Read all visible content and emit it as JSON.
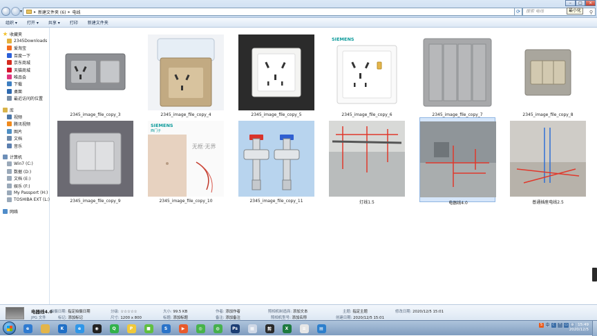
{
  "address": {
    "parts": [
      "新建文件夹 (6)",
      "电线"
    ],
    "search_placeholder": "搜索 电线",
    "tooltip": "最小化"
  },
  "toolbar": {
    "organize": "组织 ▾",
    "open": "打开 ▾",
    "share": "共享 ▾",
    "print": "打印",
    "new_folder": "新建文件夹"
  },
  "sidebar": {
    "favorites_label": "收藏夹",
    "favorites": [
      {
        "label": "2345Downloads",
        "color": "#e2b23e"
      },
      {
        "label": "爱淘宝",
        "color": "#f46b1d"
      },
      {
        "label": "百度一下",
        "color": "#2b5fd9"
      },
      {
        "label": "京东商城",
        "color": "#d52b1e"
      },
      {
        "label": "天猫商城",
        "color": "#d4142e"
      },
      {
        "label": "唯品会",
        "color": "#e0357f"
      },
      {
        "label": "下载",
        "color": "#3e7fc1"
      },
      {
        "label": "桌面",
        "color": "#2d69b0"
      },
      {
        "label": "最近访问的位置",
        "color": "#7a8ea6"
      }
    ],
    "library_label": "库",
    "libraries": [
      {
        "label": "视频",
        "color": "#4b76a8"
      },
      {
        "label": "腾讯视频",
        "color": "#f08a1c"
      },
      {
        "label": "图片",
        "color": "#4d8fc4"
      },
      {
        "label": "文档",
        "color": "#6e89a9"
      },
      {
        "label": "音乐",
        "color": "#5b7fb0"
      }
    ],
    "computer_label": "计算机",
    "drives": [
      {
        "label": "Win7 (C:)"
      },
      {
        "label": "数据 (D:)"
      },
      {
        "label": "文档 (E:)"
      },
      {
        "label": "娱乐 (F:)"
      },
      {
        "label": "My Passport (H:)"
      },
      {
        "label": "TOSHIBA EXT (L:)"
      }
    ],
    "network_label": "网络"
  },
  "files": [
    {
      "name": "2345_image_file_copy_3",
      "kind": "switch-socket-grey",
      "bg": "#ffffff"
    },
    {
      "name": "2345_image_file_copy_4",
      "kind": "socket-cover",
      "bg": "#eef2f5"
    },
    {
      "name": "2345_image_file_copy_5",
      "kind": "socket-dark",
      "bg": "#2b2b2b"
    },
    {
      "name": "2345_image_file_copy_6",
      "kind": "socket-usb",
      "bg": "#ffffff",
      "brand": "SIEMENS"
    },
    {
      "name": "2345_image_file_copy_7",
      "kind": "switch-four-grey",
      "bg": "#ffffff"
    },
    {
      "name": "2345_image_file_copy_8",
      "kind": "switch-three-gold",
      "bg": "#ffffff"
    },
    {
      "name": "2345_image_file_copy_9",
      "kind": "switch-two-silver",
      "bg": "#6b6a72"
    },
    {
      "name": "2345_image_file_copy_10",
      "kind": "glass-switch",
      "bg": "#fafafa",
      "brand": "SIEMENS",
      "brand_sub": "西门子",
      "slogan": "无框·无界"
    },
    {
      "name": "2345_image_file_copy_11",
      "kind": "valves",
      "bg": "#b8d4ee"
    },
    {
      "name": "灯线1.5",
      "kind": "room-ceiling",
      "bg": "#cfd2d3"
    },
    {
      "name": "电器线4.0",
      "kind": "room-wall",
      "bg": "#8f9599",
      "selected": true
    },
    {
      "name": "普通插座电线2.5",
      "kind": "room-floor",
      "bg": "#c9c6c1"
    }
  ],
  "details": {
    "name": "电器线4.0",
    "type": "JPG 文件",
    "k_date_taken": "拍摄日期:",
    "v_date_taken": "指定拍摄日期",
    "k_tags": "标记:",
    "v_tags": "添加标记",
    "k_rating": "分级:",
    "v_rating": "☆☆☆☆☆",
    "k_dims": "尺寸:",
    "v_dims": "1200 x 800",
    "k_size": "大小:",
    "v_size": "99.5 KB",
    "k_title": "标题:",
    "v_title": "添加标题",
    "k_author": "作者:",
    "v_author": "添加作者",
    "k_comment": "备注:",
    "v_comment": "添加备注",
    "k_maker": "照相机制造商:",
    "v_maker": "添加文本",
    "k_model": "照相机型号:",
    "v_model": "添加名称",
    "k_subject": "主题:",
    "v_subject": "指定主题",
    "k_created": "创建日期:",
    "v_created": "2020/12/5 15:01",
    "k_modified": "修改日期:",
    "v_modified": "2020/12/5 15:01"
  },
  "taskbar": {
    "apps": [
      {
        "name": "ie",
        "color": "#2f7bd1",
        "glyph": "e"
      },
      {
        "name": "folder",
        "color": "#e3b54a",
        "glyph": ""
      },
      {
        "name": "k-app",
        "color": "#1f6fc6",
        "glyph": "K"
      },
      {
        "name": "browser-blue",
        "color": "#2f96e8",
        "glyph": "e"
      },
      {
        "name": "media",
        "color": "#222222",
        "glyph": "◉"
      },
      {
        "name": "qq-green",
        "color": "#32b24a",
        "glyph": "Q"
      },
      {
        "name": "yellow-app",
        "color": "#f0c93a",
        "glyph": "P"
      },
      {
        "name": "green-app",
        "color": "#5fbf3f",
        "glyph": "■"
      },
      {
        "name": "s-app",
        "color": "#2a73c9",
        "glyph": "S"
      },
      {
        "name": "video-app",
        "color": "#e85a2c",
        "glyph": "▶"
      },
      {
        "name": "green-ball",
        "color": "#47b34a",
        "glyph": "◎"
      },
      {
        "name": "wechat",
        "color": "#46b04d",
        "glyph": "◍"
      },
      {
        "name": "ps",
        "color": "#1c3e74",
        "glyph": "Ps"
      },
      {
        "name": "paint",
        "color": "#cfd8e6",
        "glyph": "▦"
      },
      {
        "name": "jianying",
        "color": "#2a2a2a",
        "glyph": "剪"
      },
      {
        "name": "excel",
        "color": "#1d7a3e",
        "glyph": "X"
      },
      {
        "name": "notepad",
        "color": "#e6e6e6",
        "glyph": "≡"
      },
      {
        "name": "gallery",
        "color": "#2d7fcc",
        "glyph": "▤"
      }
    ],
    "ime": "中",
    "clock_time": "15:49",
    "clock_date": "2020/12/5"
  }
}
